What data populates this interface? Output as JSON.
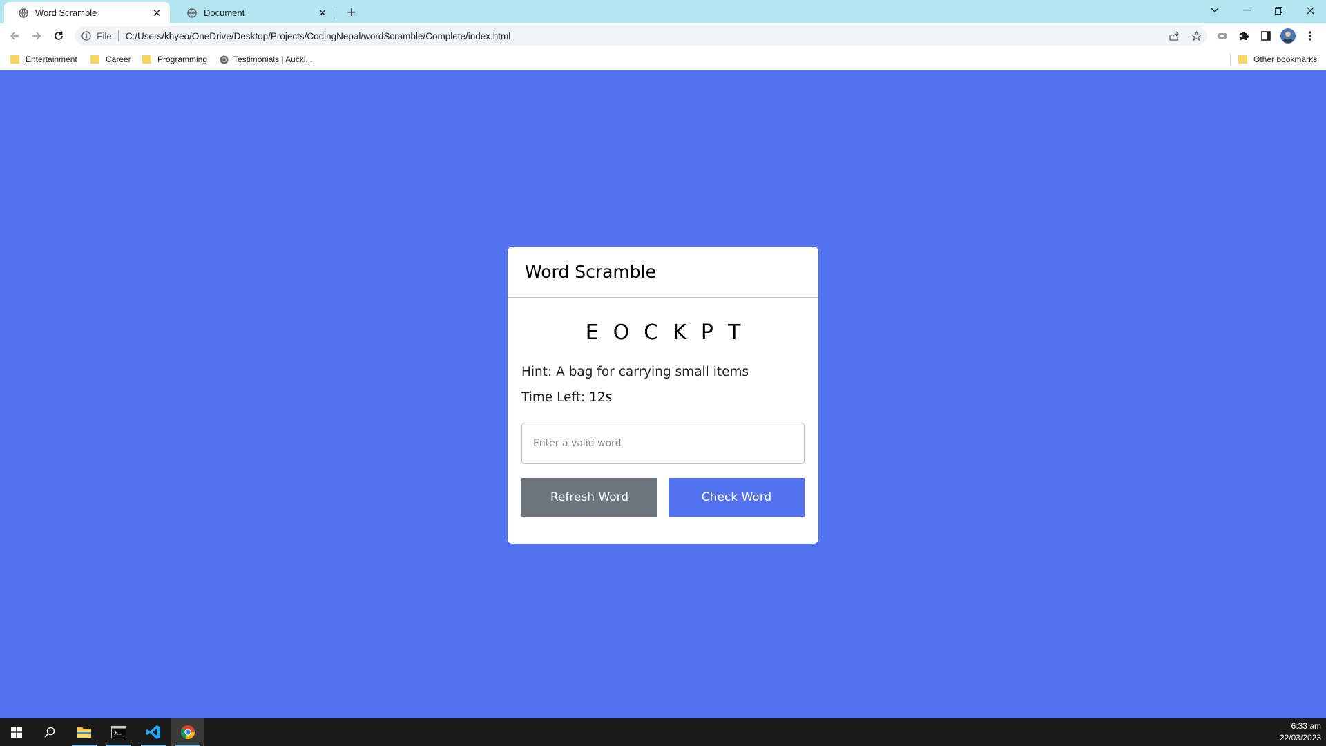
{
  "browser": {
    "tabs": [
      {
        "title": "Word Scramble",
        "active": true
      },
      {
        "title": "Document",
        "active": false
      }
    ],
    "address": {
      "scheme_label": "File",
      "url": "C:/Users/khyeo/OneDrive/Desktop/Projects/CodingNepal/wordScramble/Complete/index.html"
    },
    "bookmarks": [
      {
        "label": "Entertainment",
        "icon": "folder-icon"
      },
      {
        "label": "Career",
        "icon": "folder-icon"
      },
      {
        "label": "Programming",
        "icon": "folder-icon"
      },
      {
        "label": "Testimonials | Auckl...",
        "icon": "site-favicon-icon"
      }
    ],
    "other_bookmarks": "Other bookmarks"
  },
  "game": {
    "title": "Word Scramble",
    "scrambled_word": "EOCKPT",
    "hint_label": "Hint:",
    "hint": "A bag for carrying small items",
    "time_label": "Time Left:",
    "time_value": "12",
    "time_unit": "s",
    "input_placeholder": "Enter a valid word",
    "input_value": "",
    "refresh_label": "Refresh Word",
    "check_label": "Check Word"
  },
  "taskbar": {
    "apps": [
      "start-icon",
      "search-icon",
      "file-explorer-icon",
      "terminal-icon",
      "vscode-icon",
      "chrome-icon"
    ],
    "time": "6:33 am",
    "date": "22/03/2023"
  },
  "colors": {
    "page_background": "#5372f0",
    "refresh_button": "#6c757d",
    "check_button": "#5372f0",
    "tab_strip": "#b3e5f0"
  }
}
